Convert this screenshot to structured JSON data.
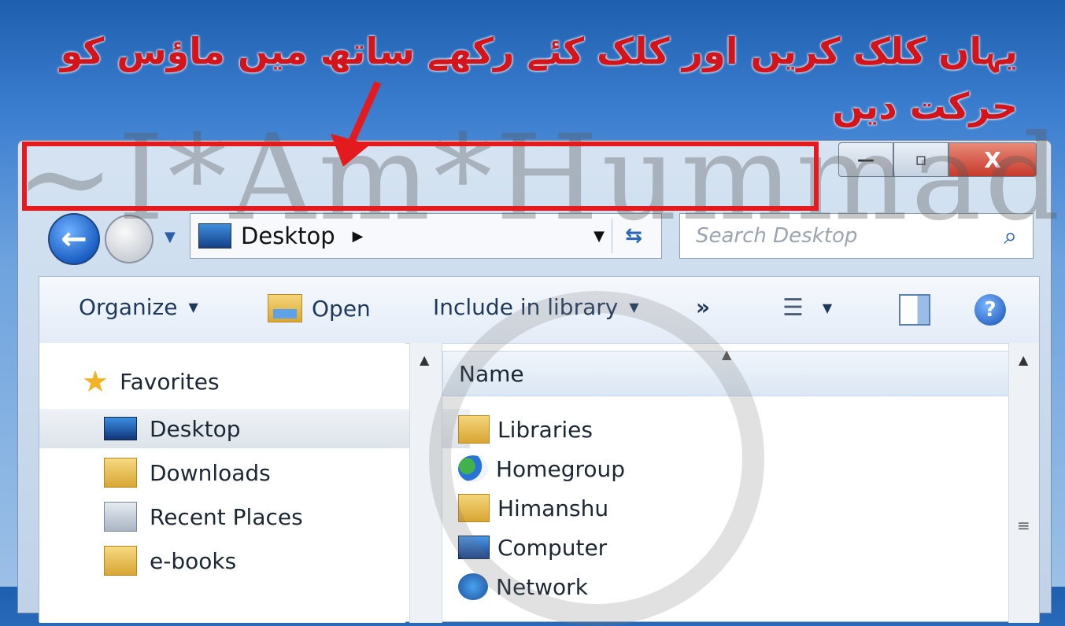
{
  "annotation": {
    "line1": "یہاں کلک کریں اور کلک کئے رکھے ساتھ میں ماؤس کو",
    "line2": "حرکت دیں"
  },
  "watermark": "~I*Am*Hummadz",
  "window": {
    "controls": {
      "minimize": "—",
      "maximize": "▫",
      "close": "X"
    }
  },
  "nav": {
    "back_glyph": "←",
    "address_path": "Desktop",
    "search_placeholder": "Search Desktop"
  },
  "toolbar": {
    "organize": "Organize",
    "open": "Open",
    "include": "Include in library",
    "more": "»"
  },
  "sidebar": {
    "items": [
      {
        "label": "Favorites",
        "icon": "star-icon"
      },
      {
        "label": "Desktop",
        "icon": "desktop-icon",
        "selected": true
      },
      {
        "label": "Downloads",
        "icon": "downloads-folder-icon"
      },
      {
        "label": "Recent Places",
        "icon": "recent-places-icon"
      },
      {
        "label": "e-books",
        "icon": "folder-icon"
      }
    ]
  },
  "filelist": {
    "column_name": "Name",
    "items": [
      {
        "label": "Libraries",
        "icon": "libraries-icon"
      },
      {
        "label": "Homegroup",
        "icon": "homegroup-icon"
      },
      {
        "label": "Himanshu",
        "icon": "user-folder-icon"
      },
      {
        "label": "Computer",
        "icon": "computer-icon"
      },
      {
        "label": "Network",
        "icon": "network-icon"
      }
    ]
  },
  "colors": {
    "annotation_red": "#d3141a",
    "highlight_border": "#e31b1f",
    "close_button": "#c7392b"
  }
}
